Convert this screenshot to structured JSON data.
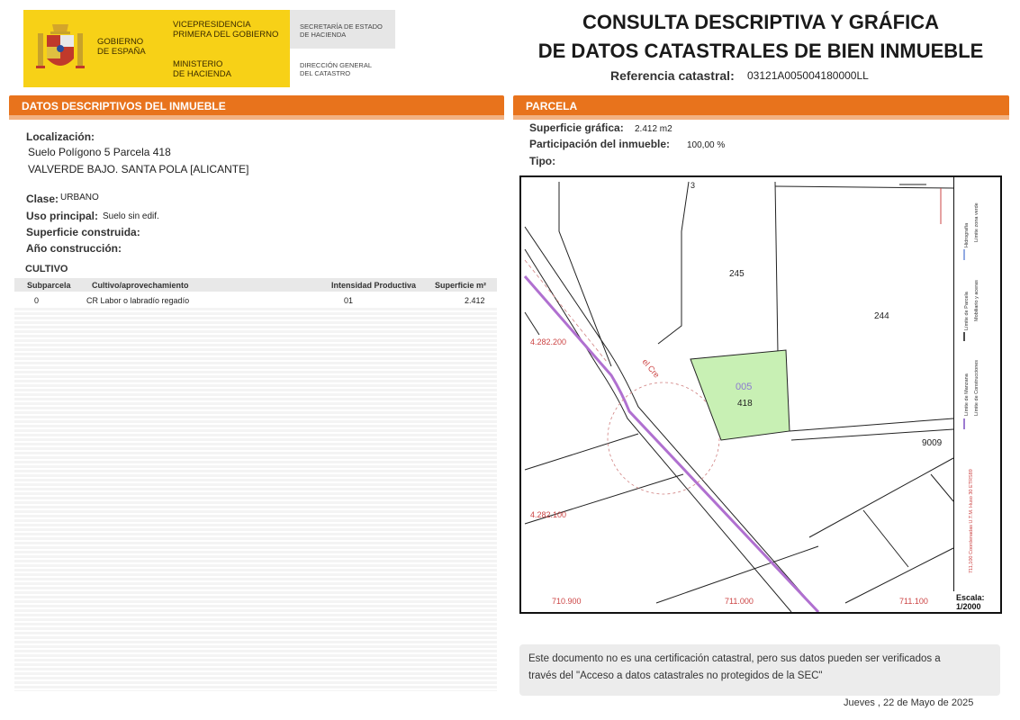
{
  "header": {
    "gov_line1": "GOBIERNO",
    "gov_line2": "DE ESPAÑA",
    "vice_line1": "VICEPRESIDENCIA",
    "vice_line2": "PRIMERA DEL GOBIERNO",
    "minis_line1": "MINISTERIO",
    "minis_line2": "DE HACIENDA",
    "sec_line1": "SECRETARÍA DE ESTADO",
    "sec_line2": "DE HACIENDA",
    "dir_line1": "DIRECCIÓN GENERAL",
    "dir_line2": "DEL CATASTRO",
    "brand_color": "#f7d117"
  },
  "title": {
    "line1": "CONSULTA DESCRIPTIVA Y GRÁFICA",
    "line2": "DE DATOS CATASTRALES DE BIEN INMUEBLE",
    "ref_label": "Referencia catastral:",
    "ref_value": "03121A005004180000LL"
  },
  "left": {
    "bar": "DATOS DESCRIPTIVOS DEL INMUEBLE",
    "loc_label": "Localización:",
    "loc_line1": "Suelo Polígono 5 Parcela 418",
    "loc_line2": "VALVERDE BAJO. SANTA POLA [ALICANTE]",
    "clase_label": "Clase:",
    "clase_value": "URBANO",
    "uso_label": "Uso principal:",
    "uso_value": "Suelo sin edif.",
    "sup_label": "Superficie construida:",
    "anio_label": "Año construcción:",
    "cultivo_title": "CULTIVO",
    "table": {
      "headers": [
        "Subparcela",
        "Cultivo/aprovechamiento",
        "Intensidad Productiva",
        "Superficie m²"
      ],
      "rows": [
        [
          "0",
          "CR Labor o labradío regadío",
          "01",
          "2.412"
        ]
      ]
    }
  },
  "right": {
    "bar": "PARCELA",
    "supg_label": "Superficie gráfica:",
    "supg_value": "2.412 m2",
    "part_label": "Participación del inmueble:",
    "part_value": "100,00 %",
    "tipo_label": "Tipo:"
  },
  "map": {
    "parcel_245": "245",
    "parcel_244": "244",
    "parcel_code": "005",
    "parcel_418": "418",
    "parcel_9009": "9009",
    "top_label": "3",
    "road_label": "el Cre",
    "y_coord_1": "4.282.200",
    "y_coord_2": "4.282.100",
    "x_coord_1": "710.900",
    "x_coord_2": "711.000",
    "x_coord_3": "711.100",
    "legend_1": "Límite de Manzana",
    "legend_2": "Límite de Parcela",
    "legend_3": "Límite de Construcciones",
    "legend_4": "Mobiliario y aceras",
    "legend_5": "Hidrografía",
    "legend_6": "Límite zona verde",
    "legend_coords": "711,100 Coordenadas U.T.M. Huso 30 ETRS89",
    "escala_label": "Escala:",
    "escala_value": "1/2000",
    "highlight_color": "#c8f0b4"
  },
  "note": {
    "text_line1": "Este documento no es una certificación catastral, pero sus datos pueden ser verificados a",
    "text_line2": "través del \"Acceso a datos catastrales no protegidos de la SEC\""
  },
  "date": "Jueves , 22 de Mayo de 2025"
}
